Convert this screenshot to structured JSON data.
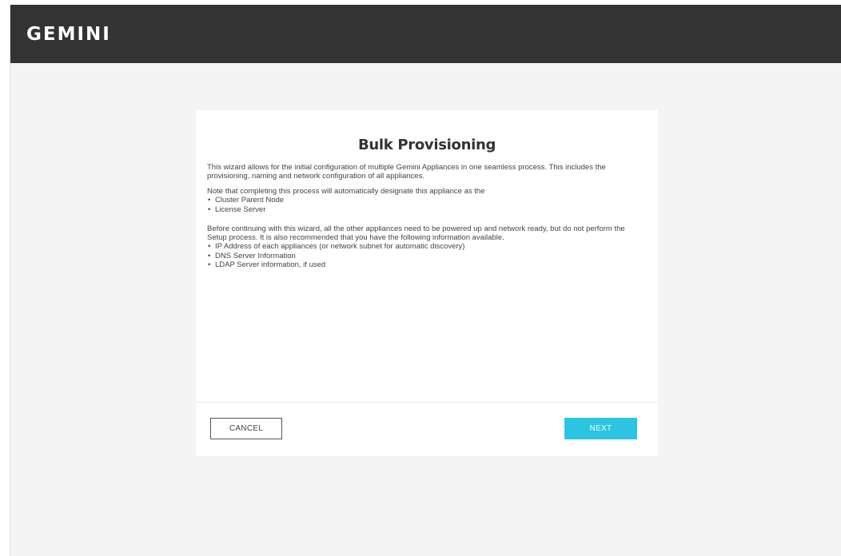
{
  "header": {
    "logo_text": "GEMINI"
  },
  "wizard": {
    "title": "Bulk Provisioning",
    "intro": "This wizard allows for the initial configuration of multiple Gemini Appliances in one seamless process. This includes the provisioning, naming and network configuration of all appliances.",
    "note": "Note that completing this process will automatically designate this appliance as the",
    "designations": [
      "Cluster Parent Node",
      "License Server"
    ],
    "prerequisites": "Before continuing with this wizard, all the other appliances need to be powered up and network ready, but do not perform the Setup process. It is also recommended that you have the following information available.",
    "required_info": [
      "IP Address of each appliances (or network subnet for automatic discovery)",
      "DNS Server Information",
      "LDAP Server information, if used"
    ],
    "cancel_label": "CANCEL",
    "next_label": "NEXT"
  },
  "colors": {
    "topbar": "#333333",
    "background": "#f4f4f4",
    "accent": "#2bc4e2"
  }
}
